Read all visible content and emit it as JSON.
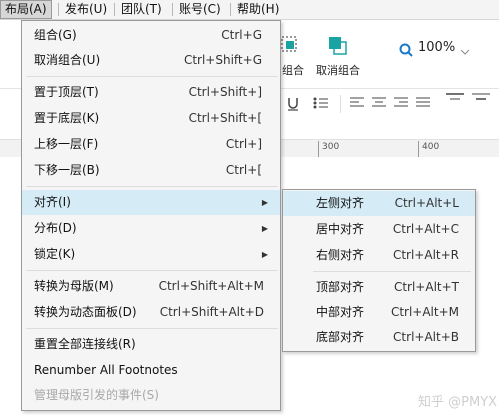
{
  "menubar": {
    "items": [
      {
        "label": "布局(A)"
      },
      {
        "label": "发布(U)"
      },
      {
        "label": "团队(T)"
      },
      {
        "label": "账号(C)"
      },
      {
        "label": "帮助(H)"
      }
    ]
  },
  "toolbar": {
    "group_partial": "组合",
    "ungroup": "取消组合",
    "zoom": "100%"
  },
  "ruler": {
    "marks": [
      "300",
      "400"
    ]
  },
  "menu": {
    "items": [
      {
        "label": "组合(G)",
        "shortcut": "Ctrl+G"
      },
      {
        "label": "取消组合(U)",
        "shortcut": "Ctrl+Shift+G"
      },
      {
        "label": "置于顶层(T)",
        "shortcut": "Ctrl+Shift+]"
      },
      {
        "label": "置于底层(K)",
        "shortcut": "Ctrl+Shift+["
      },
      {
        "label": "上移一层(F)",
        "shortcut": "Ctrl+]"
      },
      {
        "label": "下移一层(B)",
        "shortcut": "Ctrl+["
      },
      {
        "label": "对齐(I)"
      },
      {
        "label": "分布(D)"
      },
      {
        "label": "锁定(K)"
      },
      {
        "label": "转换为母版(M)",
        "shortcut": "Ctrl+Shift+Alt+M"
      },
      {
        "label": "转换为动态面板(D)",
        "shortcut": "Ctrl+Shift+Alt+D"
      },
      {
        "label": "重置全部连接线(R)"
      },
      {
        "label": "Renumber All Footnotes"
      },
      {
        "label": "管理母版引发的事件(S)"
      }
    ]
  },
  "submenu": {
    "items": [
      {
        "label": "左侧对齐",
        "shortcut": "Ctrl+Alt+L"
      },
      {
        "label": "居中对齐",
        "shortcut": "Ctrl+Alt+C"
      },
      {
        "label": "右侧对齐",
        "shortcut": "Ctrl+Alt+R"
      },
      {
        "label": "顶部对齐",
        "shortcut": "Ctrl+Alt+T"
      },
      {
        "label": "中部对齐",
        "shortcut": "Ctrl+Alt+M"
      },
      {
        "label": "底部对齐",
        "shortcut": "Ctrl+Alt+B"
      }
    ]
  },
  "watermark": "知乎 @PMYX",
  "colors": {
    "highlight": "#d5ecf7",
    "menu_bg": "#f5f5f5",
    "icon_teal": "#1aa3a3",
    "zoom_blue": "#1e78c8"
  }
}
